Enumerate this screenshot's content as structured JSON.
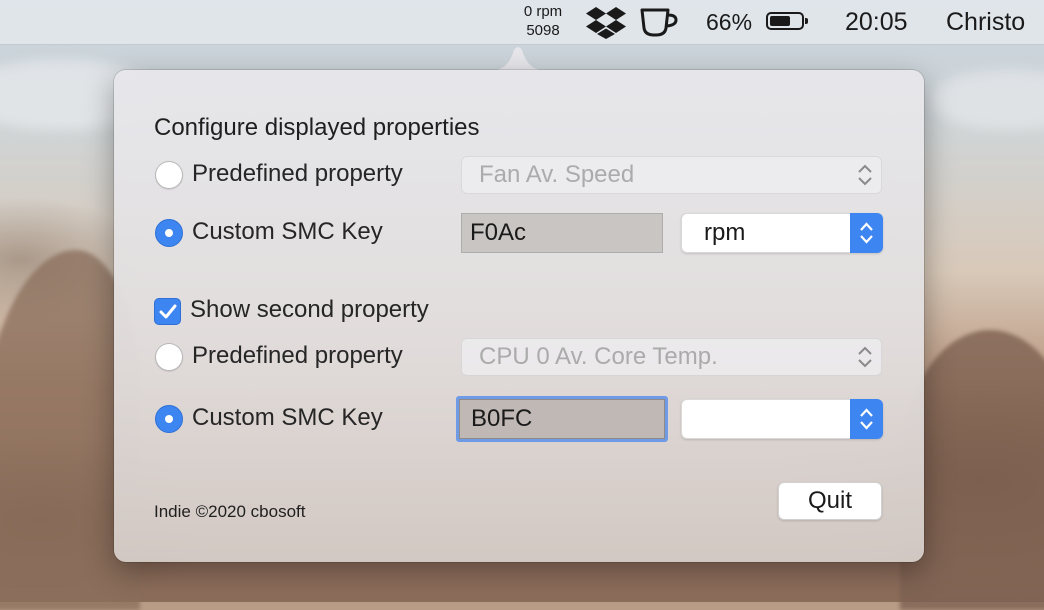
{
  "menubar": {
    "fan_speed": "0 rpm",
    "second_value": "5098",
    "battery_percent": "66%",
    "battery_level": 0.66,
    "time": "20:05",
    "user": "Christo",
    "icons": [
      "dropbox-icon",
      "coffee-cup-icon",
      "battery-icon"
    ]
  },
  "popover": {
    "title": "Configure displayed properties",
    "first": {
      "predefined_label": "Predefined property",
      "predefined_selected": false,
      "predefined_value": "Fan Av. Speed",
      "custom_label": "Custom SMC Key",
      "custom_selected": true,
      "custom_key": "F0Ac",
      "unit": "rpm"
    },
    "show_second_label": "Show second property",
    "show_second_checked": true,
    "second": {
      "predefined_label": "Predefined property",
      "predefined_selected": false,
      "predefined_value": "CPU 0 Av. Core Temp.",
      "custom_label": "Custom SMC Key",
      "custom_selected": true,
      "custom_key": "B0FC",
      "unit": ""
    },
    "footer": "Indie ©2020 cbosoft",
    "quit_label": "Quit"
  },
  "colors": {
    "accent": "#3d85f0",
    "focus_ring": "#6f9be6"
  }
}
